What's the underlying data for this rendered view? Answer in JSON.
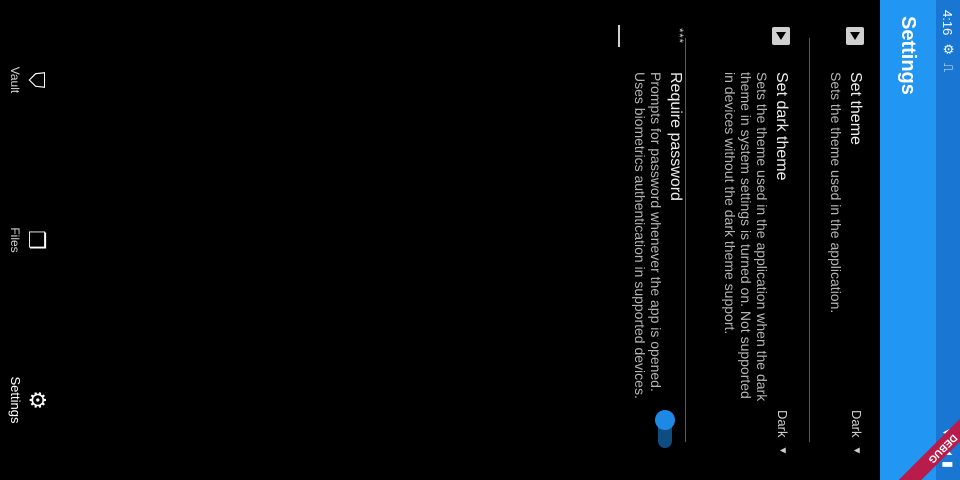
{
  "status_bar": {
    "time": "4:16",
    "icons": [
      "gear-icon",
      "a-icon",
      "wifi-icon",
      "signal-icon",
      "battery-icon"
    ]
  },
  "app_bar": {
    "title": "Settings"
  },
  "debug_banner": "DEBUG",
  "settings": [
    {
      "title": "Set theme",
      "subtitle": "Sets the theme used in the application.",
      "value": "Dark",
      "icon": "image-icon"
    },
    {
      "title": "Set dark theme",
      "subtitle": "Sets the theme used in the application when the dark theme in system settings is turned on. Not supported in devices without the dark theme support.",
      "value": "Dark",
      "icon": "image-icon"
    },
    {
      "title": "Require password",
      "subtitle": "Prompts for password whenever the app is opened. Uses biometrics authentication in supported devices.",
      "toggle": true,
      "icon": "password-icon"
    }
  ],
  "bottom_nav": [
    {
      "label": "Vault",
      "icon": "shield-icon"
    },
    {
      "label": "Files",
      "icon": "files-icon"
    },
    {
      "label": "Settings",
      "icon": "gear-icon",
      "active": true
    }
  ],
  "colors": {
    "app_bar": "#2196f3",
    "status_bar": "#1976d2",
    "accent": "#1e88e5",
    "background": "#000000"
  }
}
